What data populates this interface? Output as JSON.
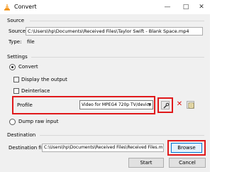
{
  "window": {
    "title": "Convert"
  },
  "source": {
    "group_label": "Source",
    "source_label": "Source:",
    "source_value": "C:\\Users\\hp\\Documents\\Received Files\\Taylor Swift - Blank Space.mp4",
    "type_label": "Type:",
    "type_value": "file"
  },
  "settings": {
    "group_label": "Settings",
    "convert_label": "Convert",
    "display_output_label": "Display the output",
    "deinterlace_label": "Deinterlace",
    "profile_label": "Profile",
    "profile_selected": "Video for MPEG4 720p TV/device",
    "dump_raw_label": "Dump raw input"
  },
  "destination": {
    "group_label": "Destination",
    "file_label": "Destination file:",
    "file_value": "C:\\Users\\hp\\Documents\\Received Files\\Received Files.mp4",
    "browse_label": "Browse"
  },
  "footer": {
    "start_label": "Start",
    "cancel_label": "Cancel"
  },
  "colors": {
    "highlight": "#e0191b",
    "dialog_bg": "#f0f0f0"
  }
}
